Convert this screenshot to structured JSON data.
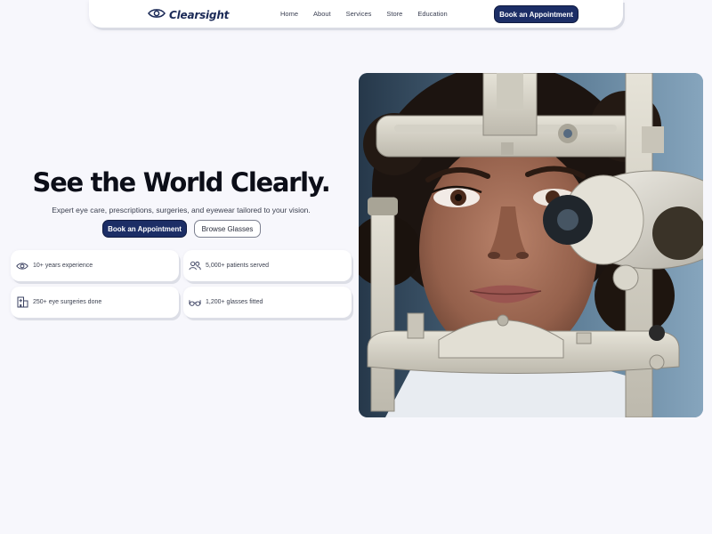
{
  "brand": {
    "name": "Clearsight",
    "icon": "eye-icon",
    "color": "#1b2a57"
  },
  "nav": {
    "links": [
      "Home",
      "About",
      "Services",
      "Store",
      "Education"
    ],
    "cta_label": "Book an Appointment"
  },
  "hero": {
    "title": "See the World Clearly.",
    "subtitle": "Expert eye care, prescriptions, surgeries, and eyewear tailored to your vision.",
    "primary_label": "Book an Appointment",
    "secondary_label": "Browse Glasses"
  },
  "stats": [
    {
      "icon": "eye-icon",
      "label": "10+ years experience"
    },
    {
      "icon": "users-icon",
      "label": "5,000+ patients served"
    },
    {
      "icon": "hospital-icon",
      "label": "250+ eye surgeries done"
    },
    {
      "icon": "glasses-icon",
      "label": "1,200+ glasses fitted"
    }
  ],
  "colors": {
    "accent": "#1c2e66",
    "background": "#f7f7fc",
    "card": "#ffffff"
  }
}
